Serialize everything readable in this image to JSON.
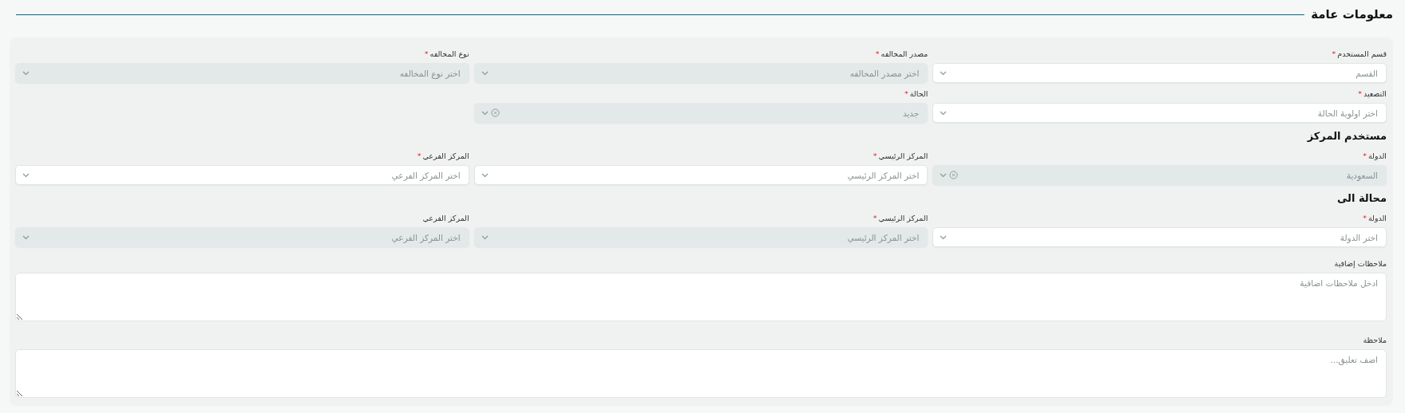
{
  "title": "معلومات عامة",
  "blocks": [
    {
      "kind": "fields",
      "fields": [
        {
          "label": "قسم المستخدم",
          "required_mark": "*",
          "placeholder": "القسم",
          "disabled": false,
          "clearable": false
        },
        {
          "label": "مصدر المخالفه",
          "required_mark": "*",
          "placeholder": "اختر مصدر المخالفه",
          "disabled": true,
          "clearable": false
        },
        {
          "label": "نوع المخالفه",
          "required_mark": "*",
          "placeholder": "اختر نوع المخالفه",
          "disabled": true,
          "clearable": false
        },
        {
          "label": "التصعيد",
          "required_mark": "*",
          "placeholder": "اختر اولوية الحالة",
          "disabled": false,
          "clearable": false
        },
        {
          "label": "الحالة",
          "required_mark": "*",
          "value": "جديد",
          "disabled": true,
          "clearable": true
        }
      ]
    },
    {
      "kind": "heading",
      "text": "مستخدم المركز"
    },
    {
      "kind": "fields",
      "fields": [
        {
          "label": "الدولة",
          "required_mark": "*",
          "value": "السعودية",
          "disabled": true,
          "clearable": true
        },
        {
          "label": "المركز الرئيسي",
          "required_mark": "*",
          "placeholder": "اختر المركز الرئيسي",
          "disabled": false,
          "clearable": false
        },
        {
          "label": "المركز الفرعي",
          "required_mark": "*",
          "placeholder": "اختر المركز الفرعي",
          "disabled": false,
          "clearable": false
        }
      ]
    },
    {
      "kind": "heading",
      "text": "محالة الى"
    },
    {
      "kind": "fields",
      "fields": [
        {
          "label": "الدولة",
          "required_mark": "*",
          "placeholder": "اختر الدولة",
          "disabled": false,
          "clearable": false
        },
        {
          "label": "المركز الرئيسي",
          "required_mark": "*",
          "placeholder": "اختر المركز الرئيسي",
          "disabled": true,
          "clearable": false
        },
        {
          "label": "المركز الفرعي",
          "placeholder": "اختر المركز الفرعي",
          "disabled": true,
          "clearable": false
        }
      ]
    },
    {
      "kind": "textarea",
      "label": "ملاحظات إضافية",
      "placeholder": "ادخل ملاحظات اضافية"
    },
    {
      "kind": "textarea",
      "label": "ملاحظة",
      "placeholder": "اضف تعليق..."
    }
  ]
}
